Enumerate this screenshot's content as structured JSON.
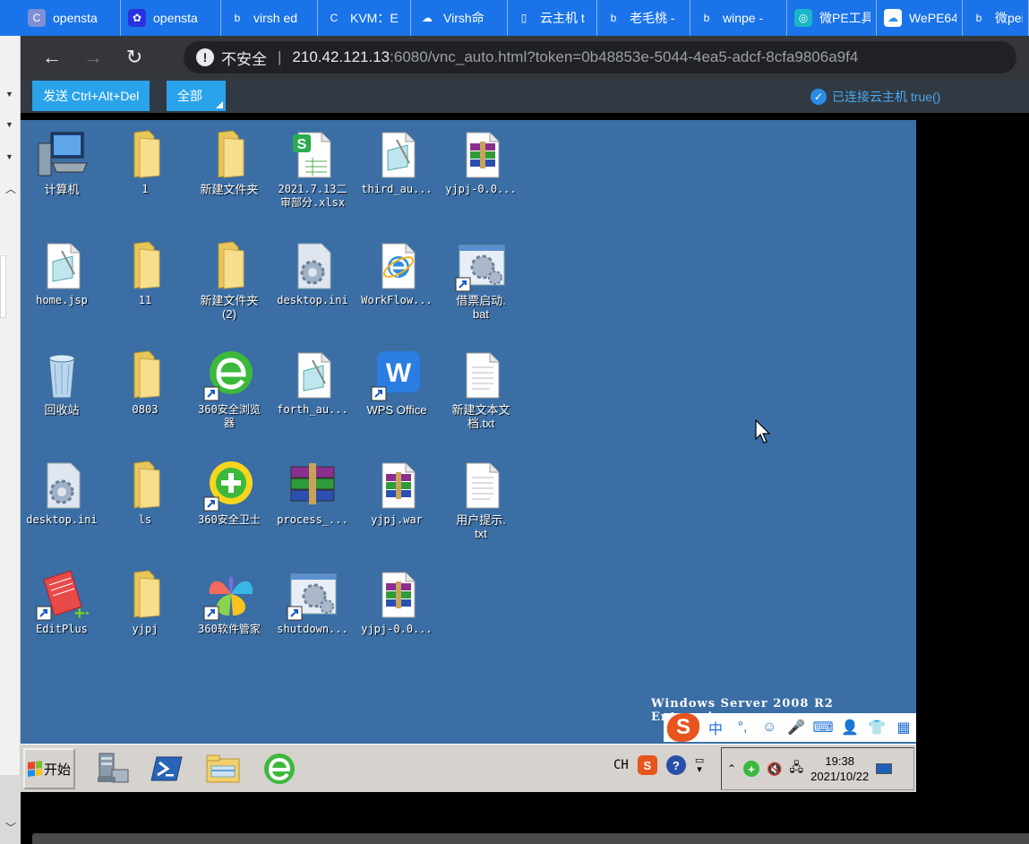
{
  "browser": {
    "tabs": [
      {
        "label": "opensta",
        "icon": "openstack-icon",
        "color": "#7f8fd6"
      },
      {
        "label": "opensta",
        "icon": "baidu-paw-icon",
        "color": "#2932e1"
      },
      {
        "label": "virsh ed",
        "icon": "bing-icon",
        "color": "#1a73e8"
      },
      {
        "label": "KVM：E",
        "icon": "csdn-icon",
        "color": "#1a73e8"
      },
      {
        "label": "Virsh命",
        "icon": "cloud-icon",
        "color": "#1a73e8"
      },
      {
        "label": "云主机 t",
        "icon": "page-icon",
        "color": "#1a73e8"
      },
      {
        "label": "老毛桃 -",
        "icon": "bing-icon",
        "color": "#1a73e8"
      },
      {
        "label": "winpe -",
        "icon": "bing-icon",
        "color": "#1a73e8"
      },
      {
        "label": "微PE工具",
        "icon": "wepe-icon",
        "color": "#19b6c9"
      },
      {
        "label": "WePE64",
        "icon": "baidu-cloud-icon",
        "color": "#fff"
      },
      {
        "label": "微peis",
        "icon": "bing-icon",
        "color": "#1a73e8"
      }
    ],
    "security_label": "不安全",
    "url_host": "210.42.121.13",
    "url_rest": ":6080/vnc_auto.html?token=0b48853e-5044-4ea5-adcf-8cfa9806a9f4"
  },
  "vnc": {
    "send_cad_label": "发送 Ctrl+Alt+Del",
    "fullscreen_label": "全部",
    "status_label": "已连接云主机 true()"
  },
  "desktop": {
    "icons": [
      {
        "name": "computer",
        "label": "计算机",
        "kind": "computer"
      },
      {
        "name": "folder-1",
        "label": "1",
        "kind": "folder"
      },
      {
        "name": "folder-new",
        "label": "新建文件夹",
        "kind": "folder"
      },
      {
        "name": "xlsx-file",
        "label": "2021.7.13二\n审部分.xlsx",
        "kind": "xlsx"
      },
      {
        "name": "third-file",
        "label": "third_au...",
        "kind": "doc"
      },
      {
        "name": "yjpj-archive-1",
        "label": "yjpj-0.0...",
        "kind": "rar"
      },
      {
        "name": "home-jsp",
        "label": "home.jsp",
        "kind": "doc"
      },
      {
        "name": "folder-11",
        "label": "11",
        "kind": "folder"
      },
      {
        "name": "folder-new-2",
        "label": "新建文件夹\n(2)",
        "kind": "folder"
      },
      {
        "name": "desktop-ini-1",
        "label": "desktop.ini",
        "kind": "gear"
      },
      {
        "name": "workflow-shortcut",
        "label": "WorkFlow...",
        "kind": "ie"
      },
      {
        "name": "bat-file",
        "label": "借票启动.\nbat",
        "kind": "gearbat"
      },
      {
        "name": "recycle-bin",
        "label": "回收站",
        "kind": "recycle"
      },
      {
        "name": "folder-0803",
        "label": "0803",
        "kind": "folder"
      },
      {
        "name": "browser-360",
        "label": "360安全浏览\n器",
        "kind": "ie360"
      },
      {
        "name": "forth-file",
        "label": "forth_au...",
        "kind": "doc"
      },
      {
        "name": "wps-office",
        "label": "WPS Office",
        "kind": "wps"
      },
      {
        "name": "new-txt",
        "label": "新建文本文\n档.txt",
        "kind": "txt"
      },
      {
        "name": "desktop-ini-2",
        "label": "desktop.ini",
        "kind": "gear"
      },
      {
        "name": "folder-ls",
        "label": "ls",
        "kind": "folder"
      },
      {
        "name": "guard-360",
        "label": "360安全卫士",
        "kind": "guard360"
      },
      {
        "name": "process-archive",
        "label": "process_...",
        "kind": "rarbig"
      },
      {
        "name": "yjpj-war",
        "label": "yjpj.war",
        "kind": "rar"
      },
      {
        "name": "user-tip-txt",
        "label": "用户提示.\ntxt",
        "kind": "txt"
      },
      {
        "name": "editplus",
        "label": "EditPlus",
        "kind": "editplus"
      },
      {
        "name": "folder-yjpj",
        "label": "yjpj",
        "kind": "folder"
      },
      {
        "name": "software-360",
        "label": "360软件管家",
        "kind": "soft360"
      },
      {
        "name": "shutdown-bat",
        "label": "shutdown...",
        "kind": "gearbat"
      },
      {
        "name": "yjpj-archive-2",
        "label": "yjpj-0.0...",
        "kind": "rar"
      }
    ],
    "watermark": "Windows Server 2008 R2 Enterprise",
    "ime": {
      "lang": "中",
      "items": [
        "°,",
        "☺",
        "🎤",
        "⌨",
        "👤",
        "👕",
        "▦"
      ]
    }
  },
  "taskbar": {
    "start_label": "开始",
    "lang": "CH",
    "time": "19:38",
    "date": "2021/10/22"
  }
}
